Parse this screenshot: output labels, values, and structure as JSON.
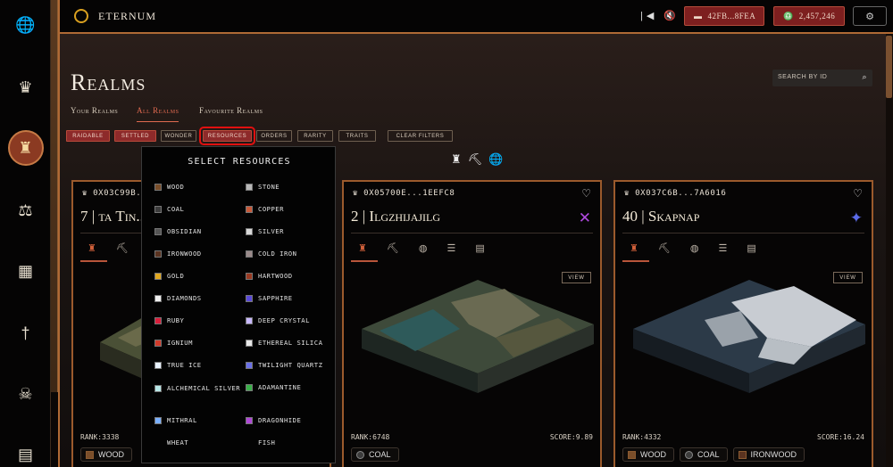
{
  "app": {
    "title": "ETERNUM"
  },
  "header": {
    "account": "42FB...8FEA",
    "balance": "2,457,246",
    "controls": [
      "skip-back-icon",
      "mute-icon",
      "skip-forward-icon"
    ]
  },
  "sidebar": {
    "items": [
      {
        "icon": "globe-icon",
        "glyph": "🌐",
        "active": false
      },
      {
        "icon": "crown-icon",
        "glyph": "♛",
        "active": false
      },
      {
        "icon": "castle-icon",
        "glyph": "♜",
        "active": true
      },
      {
        "icon": "scales-icon",
        "glyph": "⚖",
        "active": false
      },
      {
        "icon": "building-icon",
        "glyph": "▦",
        "active": false
      },
      {
        "icon": "sword-icon",
        "glyph": "†",
        "active": false
      },
      {
        "icon": "skull-icon",
        "glyph": "☠",
        "active": false
      },
      {
        "icon": "book-icon",
        "glyph": "▤",
        "active": false
      }
    ]
  },
  "page": {
    "title": "Realms",
    "search_placeholder": "SEARCH BY ID",
    "tabs": [
      "Your Realms",
      "All Realms",
      "Favourite Realms"
    ],
    "filters": [
      "RAIDABLE",
      "SETTLED",
      "WONDER",
      "RESOURCES",
      "ORDERS",
      "RARITY",
      "TRAITS",
      "CLEAR FILTERS"
    ]
  },
  "dropdown": {
    "title": "SELECT RESOURCES",
    "left": [
      {
        "label": "WOOD",
        "color": "#7a4e2a"
      },
      {
        "label": "COAL",
        "color": "#3c3c3c"
      },
      {
        "label": "OBSIDIAN",
        "color": "#555555"
      },
      {
        "label": "IRONWOOD",
        "color": "#5a3320"
      },
      {
        "label": "GOLD",
        "color": "#e0a820"
      },
      {
        "label": "DIAMONDS",
        "color": "#f0f0f0"
      },
      {
        "label": "RUBY",
        "color": "#d81e3c"
      },
      {
        "label": "IGNIUM",
        "color": "#d13a2a"
      },
      {
        "label": "TRUE ICE",
        "color": "#e8f2ff"
      },
      {
        "label": "ALCHEMICAL SILVER",
        "color": "#b8e8e8"
      },
      {
        "label": "MITHRAL",
        "color": "#7ab0ff"
      },
      {
        "label": "WHEAT",
        "color": ""
      }
    ],
    "right": [
      {
        "label": "STONE",
        "color": "#b8b8b8"
      },
      {
        "label": "COPPER",
        "color": "#c85a3a"
      },
      {
        "label": "SILVER",
        "color": "#d8d8d8"
      },
      {
        "label": "COLD IRON",
        "color": "#9a8a8a"
      },
      {
        "label": "HARTWOOD",
        "color": "#9a3a22"
      },
      {
        "label": "SAPPHIRE",
        "color": "#5a4ad8"
      },
      {
        "label": "DEEP CRYSTAL",
        "color": "#c8b8ff"
      },
      {
        "label": "ETHEREAL SILICA",
        "color": "#e8e8e8"
      },
      {
        "label": "TWILIGHT QUARTZ",
        "color": "#6a70e8"
      },
      {
        "label": "ADAMANTINE",
        "color": "#3ab04a"
      },
      {
        "label": "DRAGONHIDE",
        "color": "#b048d8"
      },
      {
        "label": "FISH",
        "color": ""
      }
    ]
  },
  "cards": [
    {
      "id": "0X03C99B...",
      "num": "7",
      "name": "ta Tin...",
      "rank": "RANK:3338",
      "score": "",
      "order_icon": "",
      "order_color": "",
      "resources": [
        {
          "label": "WOOD",
          "color": "#7a4e2a"
        },
        {
          "label": "",
          "color": "#3c3c3c"
        }
      ]
    },
    {
      "id": "0X05700E...1EEFC8",
      "num": "2",
      "name": "Ilgzhijajilg",
      "rank": "RANK:6748",
      "score": "SCORE:9.89",
      "order_icon": "✕",
      "order_color": "#b04ae0",
      "resources": [
        {
          "label": "COAL",
          "color": "#3c3c3c"
        }
      ]
    },
    {
      "id": "0X037C6B...7A6016",
      "num": "40",
      "name": "Skapnap",
      "rank": "RANK:4332",
      "score": "SCORE:16.24",
      "order_icon": "✦",
      "order_color": "#5a6ae8",
      "resources": [
        {
          "label": "WOOD",
          "color": "#7a4e2a"
        },
        {
          "label": "COAL",
          "color": "#3c3c3c"
        },
        {
          "label": "IRONWOOD",
          "color": "#5a3320"
        }
      ]
    }
  ]
}
